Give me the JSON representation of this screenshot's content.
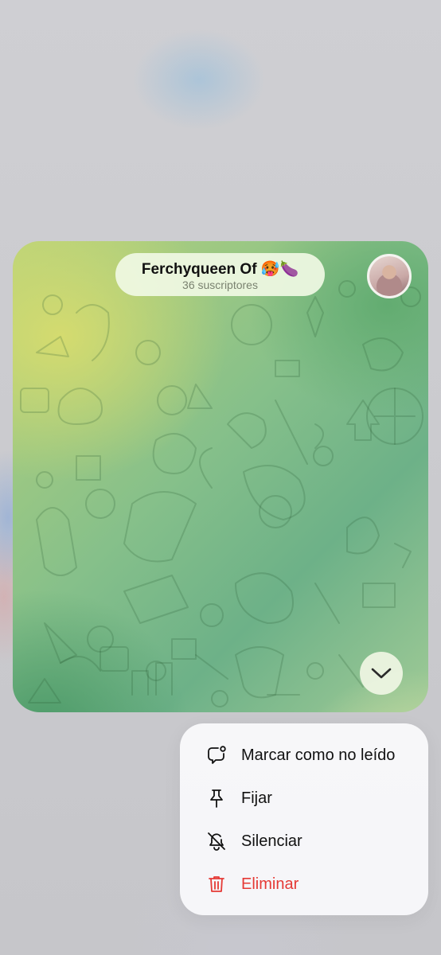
{
  "channel": {
    "title": "Ferchyqueen Of 🥵🍆",
    "subtitle": "36 suscriptores"
  },
  "icons": {
    "avatar": "profile-avatar",
    "scroll": "chevron-down-icon"
  },
  "menu": {
    "items": [
      {
        "label": "Marcar como no leído",
        "icon": "mark-unread-icon"
      },
      {
        "label": "Fijar",
        "icon": "pin-icon"
      },
      {
        "label": "Silenciar",
        "icon": "bell-slash-icon"
      },
      {
        "label": "Eliminar",
        "icon": "trash-icon",
        "color": "#e53935"
      }
    ]
  }
}
